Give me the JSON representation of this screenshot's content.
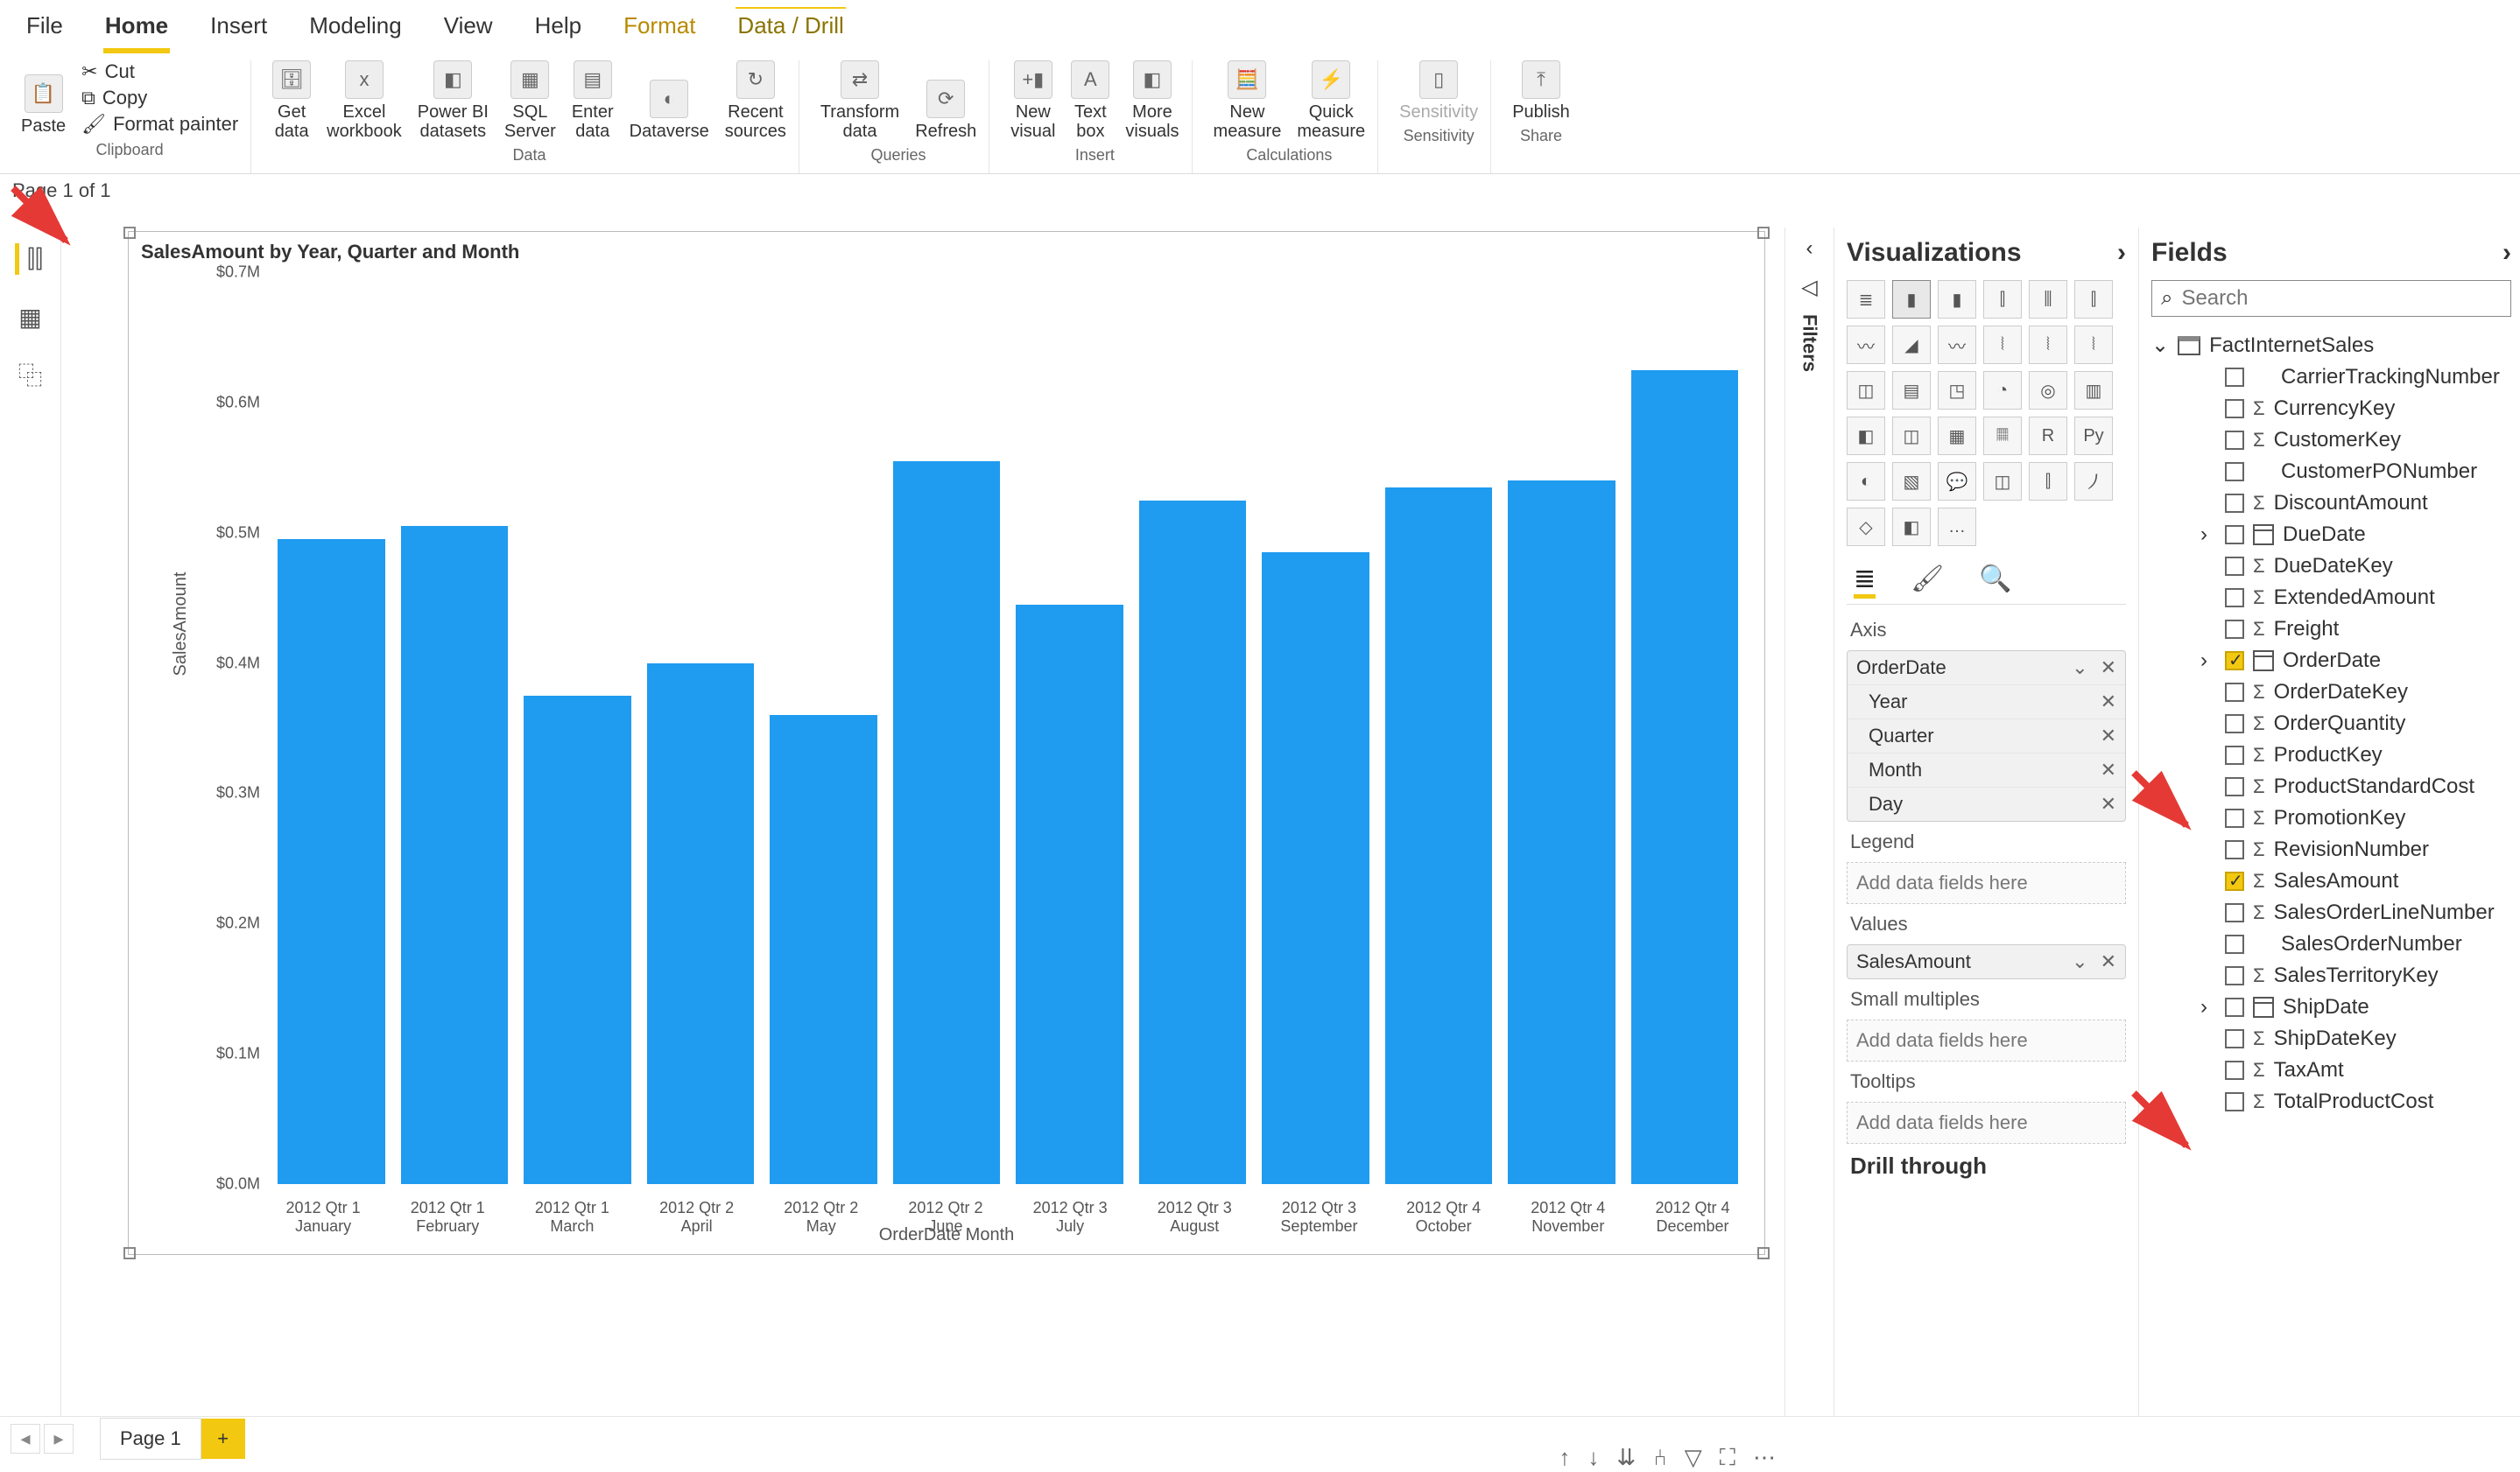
{
  "menu": {
    "file": "File",
    "home": "Home",
    "insert": "Insert",
    "modeling": "Modeling",
    "view": "View",
    "help": "Help",
    "format": "Format",
    "datadrill": "Data / Drill"
  },
  "ribbon": {
    "clipboard": {
      "paste": "Paste",
      "cut": "Cut",
      "copy": "Copy",
      "fmtpainter": "Format painter",
      "group": "Clipboard"
    },
    "data": {
      "getdata": "Get\ndata",
      "excel": "Excel\nworkbook",
      "pbi": "Power BI\ndatasets",
      "sql": "SQL\nServer",
      "enter": "Enter\ndata",
      "dataverse": "Dataverse",
      "recent": "Recent\nsources",
      "group": "Data"
    },
    "queries": {
      "transform": "Transform\ndata",
      "refresh": "Refresh",
      "group": "Queries"
    },
    "insert": {
      "newvis": "New\nvisual",
      "textbox": "Text\nbox",
      "more": "More\nvisuals",
      "group": "Insert"
    },
    "calc": {
      "newm": "New\nmeasure",
      "quickm": "Quick\nmeasure",
      "group": "Calculations"
    },
    "sens": {
      "sens": "Sensitivity",
      "group": "Sensitivity"
    },
    "share": {
      "publish": "Publish",
      "group": "Share"
    }
  },
  "filters_label": "Filters",
  "visualizations": {
    "title": "Visualizations"
  },
  "wells": {
    "axis": "Axis",
    "axis_field": "OrderDate",
    "axis_levels": [
      "Year",
      "Quarter",
      "Month",
      "Day"
    ],
    "legend": "Legend",
    "legend_ph": "Add data fields here",
    "values": "Values",
    "values_field": "SalesAmount",
    "small": "Small multiples",
    "small_ph": "Add data fields here",
    "tooltips": "Tooltips",
    "tooltips_ph": "Add data fields here",
    "drillthrough": "Drill through"
  },
  "fields": {
    "title": "Fields",
    "search_ph": "Search",
    "table": "FactInternetSales",
    "cols": [
      {
        "name": "CarrierTrackingNumber",
        "sigma": false
      },
      {
        "name": "CurrencyKey",
        "sigma": true
      },
      {
        "name": "CustomerKey",
        "sigma": true
      },
      {
        "name": "CustomerPONumber",
        "sigma": false
      },
      {
        "name": "DiscountAmount",
        "sigma": true
      },
      {
        "name": "DueDate",
        "hier": true
      },
      {
        "name": "DueDateKey",
        "sigma": true
      },
      {
        "name": "ExtendedAmount",
        "sigma": true
      },
      {
        "name": "Freight",
        "sigma": true
      },
      {
        "name": "OrderDate",
        "hier": true,
        "checked": true
      },
      {
        "name": "OrderDateKey",
        "sigma": true
      },
      {
        "name": "OrderQuantity",
        "sigma": true
      },
      {
        "name": "ProductKey",
        "sigma": true
      },
      {
        "name": "ProductStandardCost",
        "sigma": true
      },
      {
        "name": "PromotionKey",
        "sigma": true
      },
      {
        "name": "RevisionNumber",
        "sigma": true
      },
      {
        "name": "SalesAmount",
        "sigma": true,
        "checked": true
      },
      {
        "name": "SalesOrderLineNumber",
        "sigma": true
      },
      {
        "name": "SalesOrderNumber",
        "sigma": false
      },
      {
        "name": "SalesTerritoryKey",
        "sigma": true
      },
      {
        "name": "ShipDate",
        "hier": true
      },
      {
        "name": "ShipDateKey",
        "sigma": true
      },
      {
        "name": "TaxAmt",
        "sigma": true
      },
      {
        "name": "TotalProductCost",
        "sigma": true
      }
    ]
  },
  "chart_data": {
    "type": "bar",
    "title": "SalesAmount by Year, Quarter and Month",
    "xlabel": "OrderDate Month",
    "ylabel": "SalesAmount",
    "ylim": [
      0,
      0.7
    ],
    "yticks": [
      "$0.0M",
      "$0.1M",
      "$0.2M",
      "$0.3M",
      "$0.4M",
      "$0.5M",
      "$0.6M",
      "$0.7M"
    ],
    "categories": [
      "2012 Qtr 1 January",
      "2012 Qtr 1 February",
      "2012 Qtr 1 March",
      "2012 Qtr 2 April",
      "2012 Qtr 2 May",
      "2012 Qtr 2 June",
      "2012 Qtr 3 July",
      "2012 Qtr 3 August",
      "2012 Qtr 3 September",
      "2012 Qtr 4 October",
      "2012 Qtr 4 November",
      "2012 Qtr 4 December"
    ],
    "values": [
      0.495,
      0.505,
      0.375,
      0.4,
      0.36,
      0.555,
      0.445,
      0.525,
      0.485,
      0.535,
      0.54,
      0.625
    ]
  },
  "page": {
    "tab": "Page 1",
    "status": "Page 1 of 1"
  }
}
